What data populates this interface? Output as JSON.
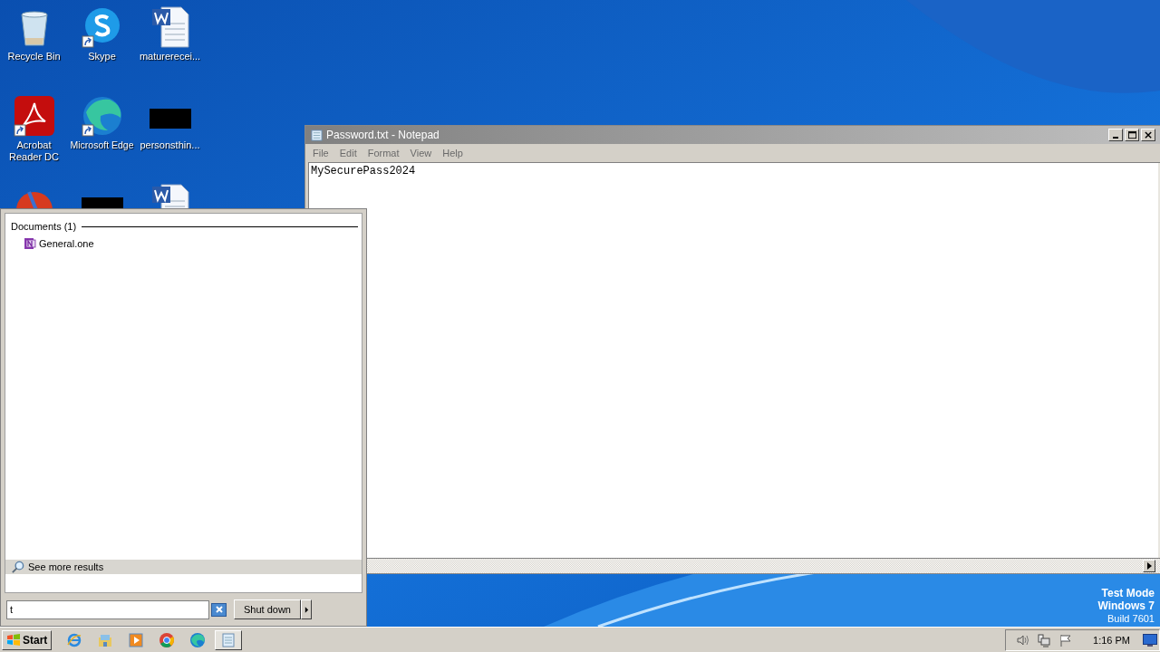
{
  "desktop_icons": [
    {
      "label": "Recycle Bin",
      "kind": "recycle"
    },
    {
      "label": "Skype",
      "kind": "skype",
      "shortcut": true
    },
    {
      "label": "maturerecei...",
      "kind": "word"
    },
    {
      "label": "Acrobat Reader DC",
      "kind": "acrobat",
      "shortcut": true
    },
    {
      "label": "Microsoft Edge",
      "kind": "edge",
      "shortcut": true
    },
    {
      "label": "personsthin...",
      "kind": "black"
    },
    {
      "kind": "ccleaner"
    },
    {
      "kind": "black"
    },
    {
      "kind": "word"
    }
  ],
  "notepad": {
    "title": "Password.txt - Notepad",
    "menu": [
      "File",
      "Edit",
      "Format",
      "View",
      "Help"
    ],
    "content": "MySecurePass2024"
  },
  "start_menu": {
    "group": "Documents (1)",
    "results": [
      {
        "label": "General.one"
      }
    ],
    "see_more": "See more results",
    "search_value": "t",
    "shutdown": "Shut down"
  },
  "desktop_notice": [
    "Test Mode",
    "Windows 7",
    "Build 7601"
  ],
  "taskbar": {
    "start": "Start",
    "apps": [
      {
        "kind": "ie",
        "active": false
      },
      {
        "kind": "explorer",
        "active": false
      },
      {
        "kind": "media",
        "active": false
      },
      {
        "kind": "chrome",
        "active": false
      },
      {
        "kind": "edge",
        "active": false
      },
      {
        "kind": "notepad",
        "active": true
      }
    ],
    "time": "1:16 PM"
  }
}
